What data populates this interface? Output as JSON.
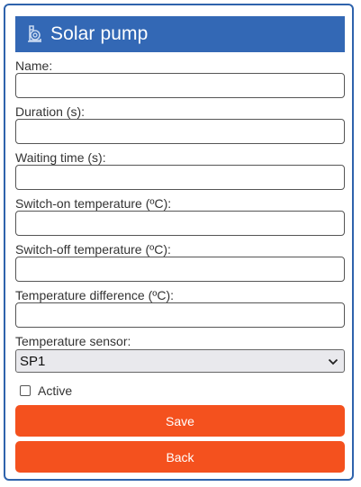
{
  "header": {
    "title": "Solar pump",
    "icon": "pump-icon"
  },
  "form": {
    "name_label": "Name:",
    "name_value": "",
    "duration_label": "Duration (s):",
    "duration_value": "",
    "waiting_label": "Waiting time (s):",
    "waiting_value": "",
    "switch_on_label": "Switch-on temperature (ºC):",
    "switch_on_value": "",
    "switch_off_label": "Switch-off temperature (ºC):",
    "switch_off_value": "",
    "temp_diff_label": "Temperature difference (ºC):",
    "temp_diff_value": "",
    "sensor_label": "Temperature sensor:",
    "sensor_selected": "SP1",
    "active_label": "Active",
    "active_checked": false
  },
  "buttons": {
    "save": "Save",
    "back": "Back"
  },
  "colors": {
    "header_bg": "#3368b5",
    "button_bg": "#f4511e",
    "border": "#2f63ac"
  }
}
